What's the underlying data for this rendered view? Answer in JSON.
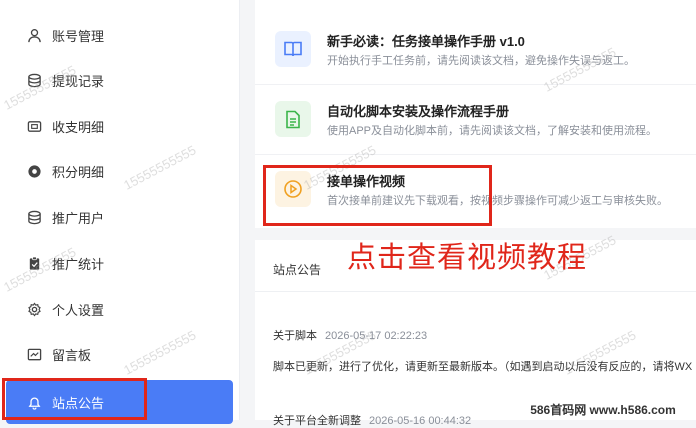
{
  "sidebar": {
    "items": [
      {
        "label": "账号管理",
        "icon": "user-icon"
      },
      {
        "label": "提现记录",
        "icon": "database-icon"
      },
      {
        "label": "收支明细",
        "icon": "wallet-icon"
      },
      {
        "label": "积分明细",
        "icon": "points-icon"
      },
      {
        "label": "推广用户",
        "icon": "database-icon"
      },
      {
        "label": "推广统计",
        "icon": "clipboard-icon"
      },
      {
        "label": "个人设置",
        "icon": "gear-icon"
      },
      {
        "label": "留言板",
        "icon": "message-icon"
      },
      {
        "label": "站点公告",
        "icon": "bell-icon",
        "active": true
      }
    ]
  },
  "docs": [
    {
      "title": "新手必读：任务接单操作手册 v1.0",
      "desc": "开始执行手工任务前，请先阅读该文档，避免操作失误与返工。",
      "icon": "book-icon",
      "color": "#4a7cf6",
      "bg": "#eaf1ff"
    },
    {
      "title": "自动化脚本安装及操作流程手册",
      "desc": "使用APP及自动化脚本前，请先阅读该文档，了解安装和使用流程。",
      "icon": "document-icon",
      "color": "#3bb54a",
      "bg": "#e9f7ea"
    },
    {
      "title": "接单操作视频",
      "desc": "首次接单前建议先下载观看，按视频步骤操作可减少返工与审核失败。",
      "icon": "play-icon",
      "color": "#f0a020",
      "bg": "#fdf3e2"
    }
  ],
  "notice": {
    "heading": "站点公告",
    "items": [
      {
        "title": "关于脚本",
        "time": "2026-05-17 02:22:23",
        "body": "脚本已更新，进行了优化，请更新至最新版本。（如遇到启动以后没有反应的，请将WX"
      },
      {
        "title": "关于平台全新调整",
        "time": "2026-05-16 00:44:32"
      }
    ]
  },
  "annotation": "点击查看视频教程",
  "watermarks": [
    "15555555555",
    "15555555555",
    "15555555555",
    "15555555555",
    "15555555555",
    "15555555555",
    "15555555555",
    "15555555555",
    "15555555555"
  ],
  "site_watermark": "586首码网 www.h586.com",
  "colors": {
    "accent": "#4a7cf6",
    "highlight": "#e0261a"
  }
}
